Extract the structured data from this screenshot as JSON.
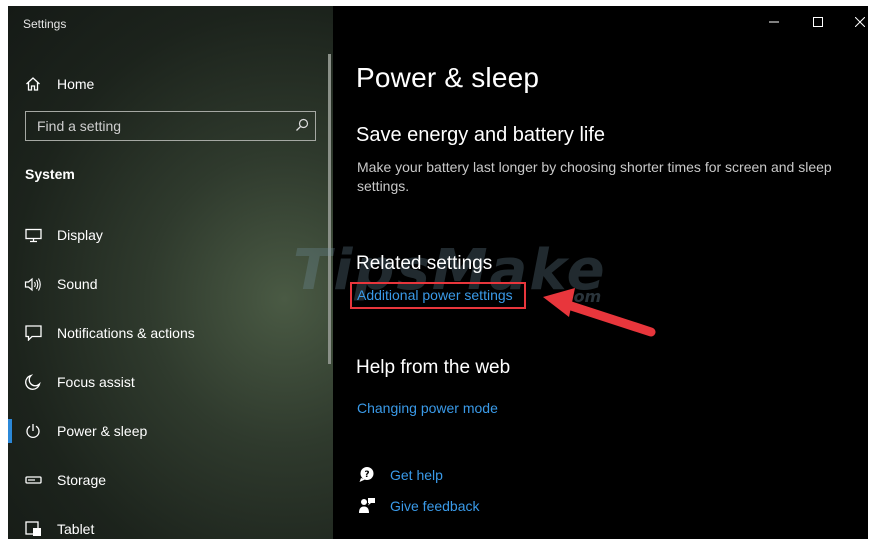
{
  "window": {
    "title": "Settings"
  },
  "sidebar": {
    "home_label": "Home",
    "search_placeholder": "Find a setting",
    "group_title": "System",
    "items": [
      {
        "label": "Display",
        "icon": "monitor-icon"
      },
      {
        "label": "Sound",
        "icon": "speaker-icon"
      },
      {
        "label": "Notifications & actions",
        "icon": "notification-icon"
      },
      {
        "label": "Focus assist",
        "icon": "moon-icon"
      },
      {
        "label": "Power & sleep",
        "icon": "power-icon",
        "active": true
      },
      {
        "label": "Storage",
        "icon": "storage-icon"
      },
      {
        "label": "Tablet",
        "icon": "tablet-icon"
      }
    ]
  },
  "main": {
    "page_title": "Power & sleep",
    "save_energy": {
      "heading": "Save energy and battery life",
      "description": "Make your battery last longer by choosing shorter times for screen and sleep settings."
    },
    "related": {
      "heading": "Related settings",
      "link": "Additional power settings"
    },
    "help": {
      "heading": "Help from the web",
      "link": "Changing power mode"
    },
    "footer": {
      "get_help": "Get help",
      "give_feedback": "Give feedback"
    }
  },
  "watermark": {
    "text": "TipsMake",
    "suffix": ".com"
  },
  "colors": {
    "accent": "#2b88d8",
    "link": "#3a9ae8",
    "annotation": "#e8363c"
  }
}
